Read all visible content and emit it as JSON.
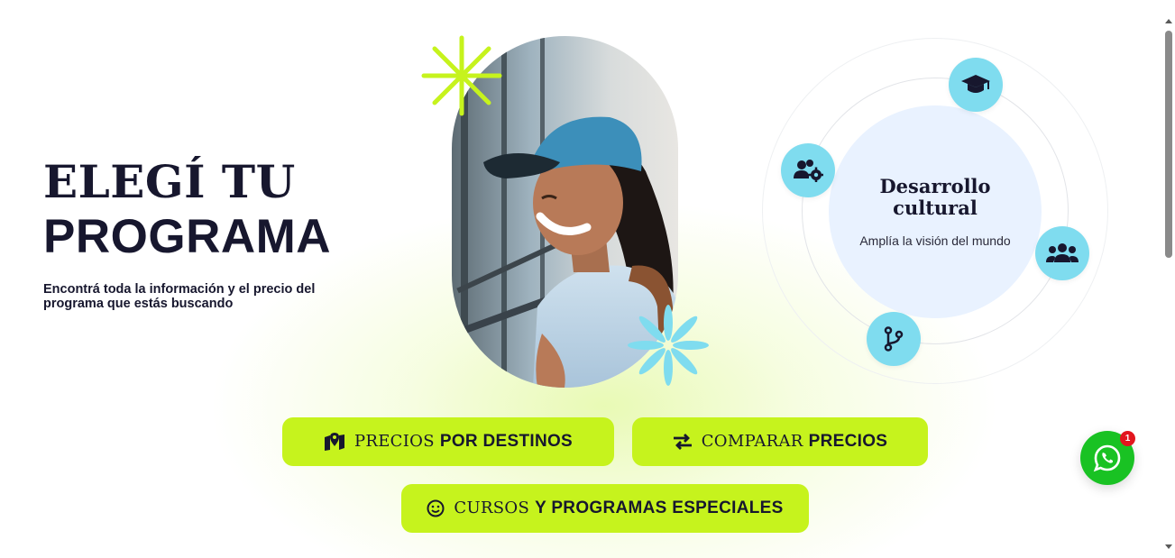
{
  "hero": {
    "title_line1": "ELEGÍ TU",
    "title_line2": "PROGRAMA",
    "subtitle": "Encontrá toda la información y el precio del programa que estás buscando"
  },
  "orbit": {
    "title": "Desarrollo cultural",
    "description": "Amplía la visión del mundo",
    "nodes": [
      "graduation-cap-icon",
      "users-cog-icon",
      "users-icon",
      "code-branch-icon"
    ]
  },
  "buttons": {
    "destinos": {
      "serif": "PRECIOS",
      "bold": "POR DESTINOS",
      "icon": "map-marker-icon"
    },
    "comparar": {
      "serif": "COMPARAR",
      "bold": "PRECIOS",
      "icon": "exchange-icon"
    },
    "cursos": {
      "serif": "CURSOS",
      "bold": "Y PROGRAMAS ESPECIALES",
      "icon": "smile-icon"
    }
  },
  "whatsapp": {
    "badge": "1",
    "icon": "whatsapp-icon"
  },
  "colors": {
    "accent_lime": "#c6f31d",
    "node_cyan": "#7fdcef",
    "center_blue": "#e9f2ff",
    "text_dark": "#17172e",
    "whatsapp_green": "#19c223",
    "badge_red": "#e2161e"
  }
}
